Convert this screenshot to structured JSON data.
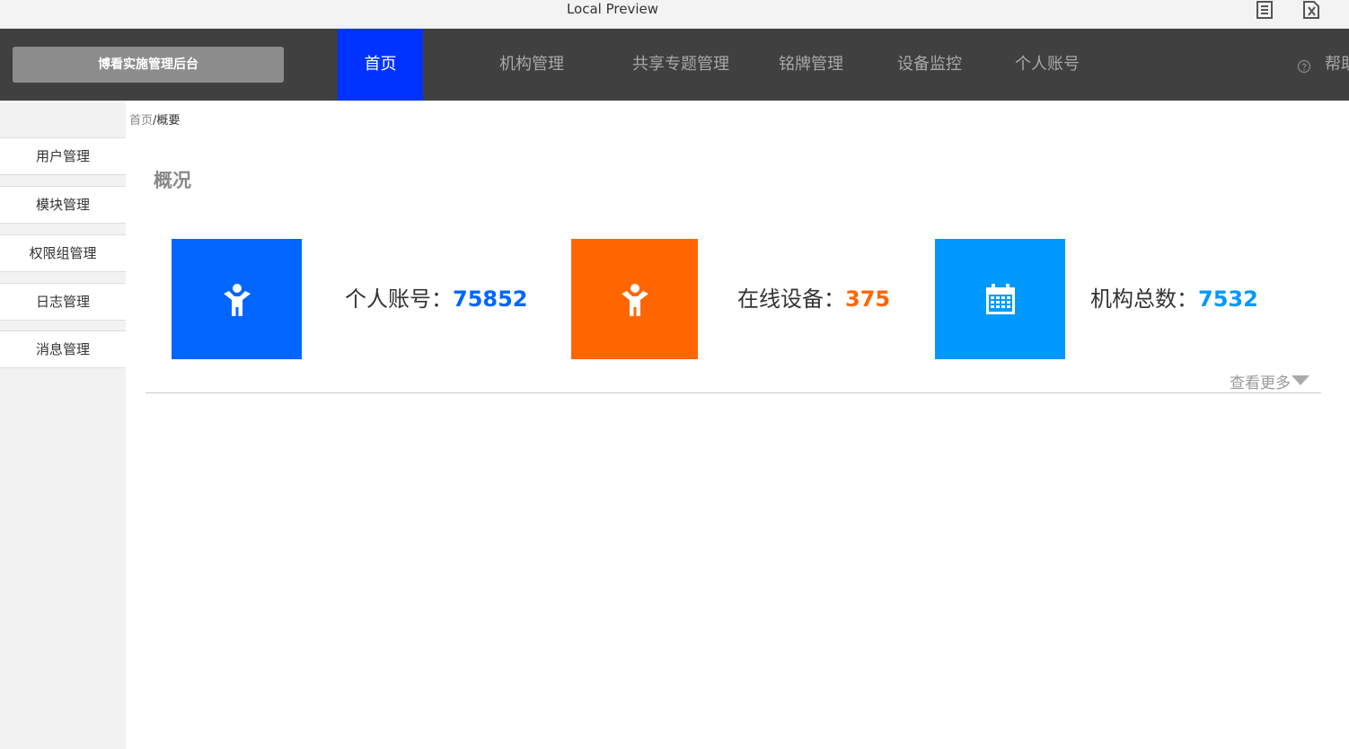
{
  "window": {
    "title": "Local Preview",
    "icons": [
      "document-icon",
      "excel-icon"
    ]
  },
  "navbar": {
    "brand": "博看实施管理后台",
    "items": [
      {
        "label": "首页",
        "active": true
      },
      {
        "label": "机构管理",
        "active": false
      },
      {
        "label": "共享专题管理",
        "active": false
      },
      {
        "label": "铭牌管理",
        "active": false
      },
      {
        "label": "设备监控",
        "active": false
      },
      {
        "label": "个人账号",
        "active": false
      }
    ],
    "help_label": "帮助"
  },
  "sidebar": {
    "items": [
      {
        "label": "用户管理"
      },
      {
        "label": "模块管理"
      },
      {
        "label": "权限组管理"
      },
      {
        "label": "日志管理"
      },
      {
        "label": "消息管理"
      }
    ]
  },
  "breadcrumb": {
    "home": "首页",
    "separator": "/",
    "current": "概要"
  },
  "overview": {
    "title": "概况",
    "cards": [
      {
        "label": "个人账号：",
        "value": "75852",
        "color": "#0066ff",
        "icon": "person-icon"
      },
      {
        "label": "在线设备：",
        "value": "375",
        "color": "#ff6600",
        "icon": "person-icon"
      },
      {
        "label": "机构总数：",
        "value": "7532",
        "color": "#0099ff",
        "icon": "calendar-icon"
      }
    ],
    "more_label": "查看更多"
  }
}
